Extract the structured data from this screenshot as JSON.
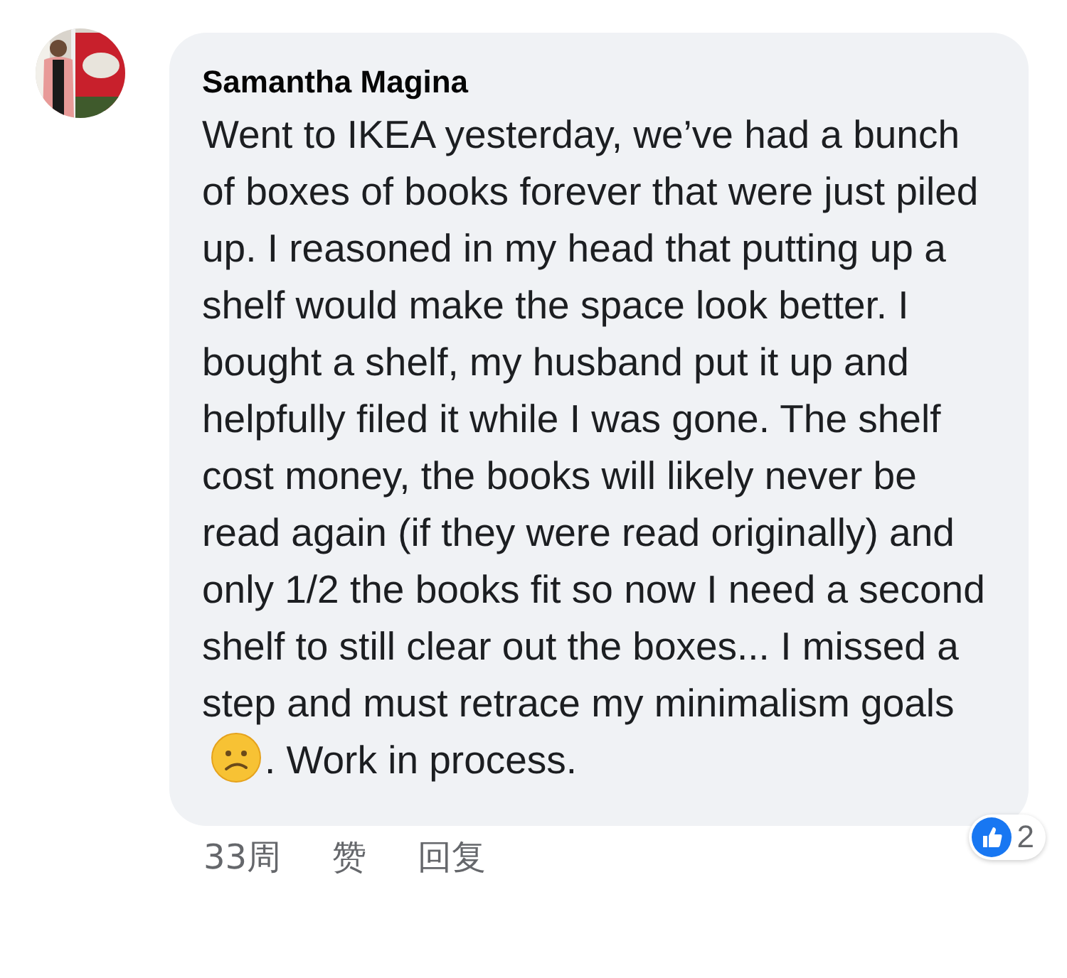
{
  "comment": {
    "author": "Samantha Magina",
    "body": [
      "Went to IKEA yesterday, we’ve had a bunch of boxes of books forever that were just piled up. I reasoned in my head that putting up a shelf would make the space look better. I bought a shelf, my husband put it up and helpfully filed it while I was gone. The shelf cost money, the books will likely never be read again (if they were read originally) and only 1/2 the books fit so now I need a second shelf to still clear out the boxes... I missed a step and must retrace my minimalism goals",
      ". Work in process."
    ],
    "reactions": {
      "count": "2"
    },
    "time": "33周",
    "actions": [
      "赞",
      "回复"
    ]
  }
}
